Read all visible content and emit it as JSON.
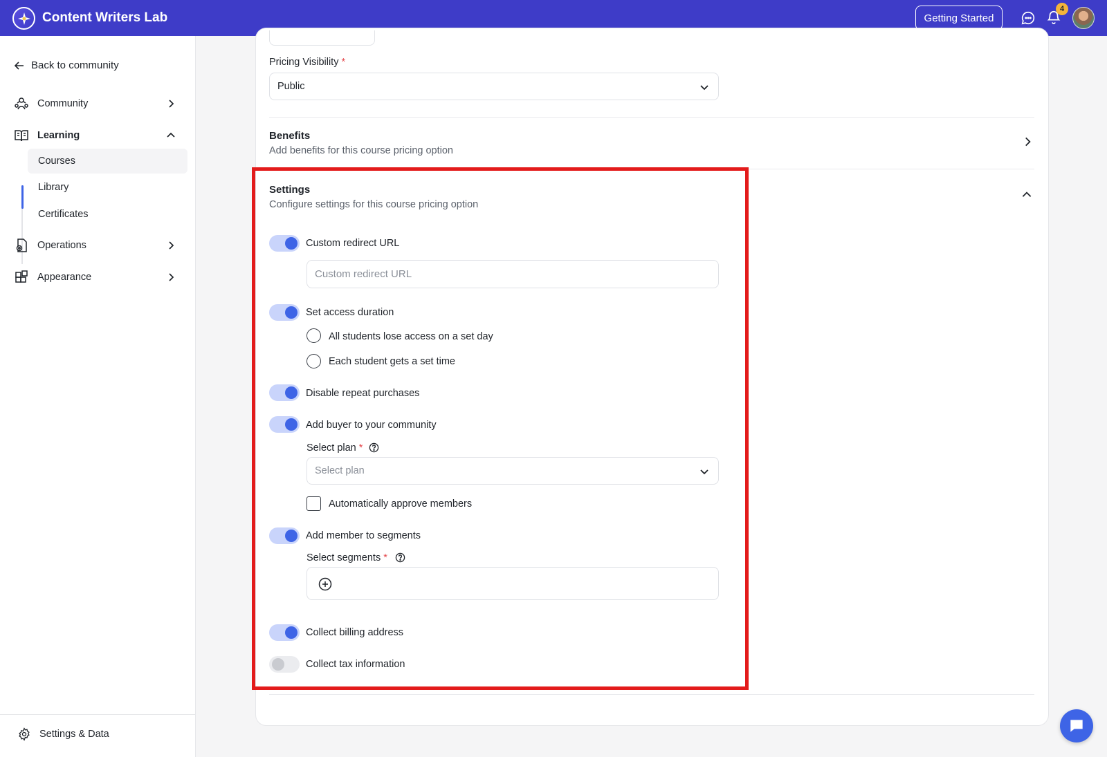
{
  "header": {
    "brand": "Content Writers Lab",
    "getting_started": "Getting Started",
    "notification_count": "4"
  },
  "sidebar": {
    "back": "Back to community",
    "items": {
      "community": "Community",
      "learning": "Learning",
      "operations": "Operations",
      "appearance": "Appearance"
    },
    "learning_sub": {
      "courses": "Courses",
      "library": "Library",
      "certificates": "Certificates"
    },
    "settings_data": "Settings & Data"
  },
  "main": {
    "pricing_visibility": {
      "label": "Pricing Visibility",
      "required": "*",
      "value": "Public"
    },
    "benefits": {
      "title": "Benefits",
      "subtitle": "Add benefits for this course pricing option"
    },
    "settings": {
      "title": "Settings",
      "subtitle": "Configure settings for this course pricing option",
      "custom_redirect": {
        "label": "Custom redirect URL",
        "placeholder": "Custom redirect URL",
        "enabled": true
      },
      "access_duration": {
        "label": "Set access duration",
        "enabled": true,
        "options": [
          "All students lose access on a set day",
          "Each student gets a set time"
        ]
      },
      "disable_repeat": {
        "label": "Disable repeat purchases",
        "enabled": true
      },
      "add_buyer": {
        "label": "Add buyer to your community",
        "enabled": true,
        "select_plan_label": "Select plan",
        "required": "*",
        "select_plan_placeholder": "Select plan",
        "auto_approve": "Automatically approve members"
      },
      "add_segments": {
        "label": "Add member to segments",
        "enabled": true,
        "select_segments_label": "Select segments",
        "required": "*"
      },
      "billing": {
        "label": "Collect billing address",
        "enabled": true
      },
      "tax": {
        "label": "Collect tax information",
        "enabled": false
      }
    }
  },
  "colors": {
    "header_bg": "#3e3cc8",
    "accent": "#3e64e6",
    "highlight": "#e31b1b"
  }
}
